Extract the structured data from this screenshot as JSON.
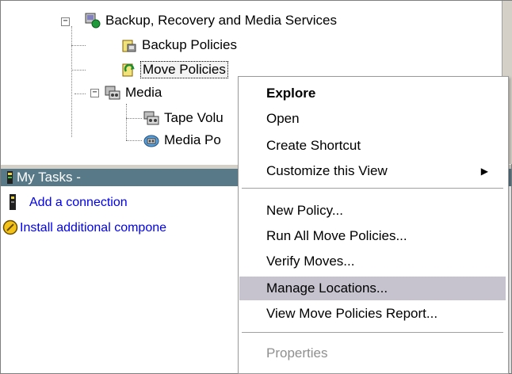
{
  "tree": {
    "root": {
      "label": "Backup, Recovery and Media Services",
      "expander": "−",
      "icon": "backup-services-icon"
    },
    "items": [
      {
        "label": "Backup Policies",
        "icon": "backup-policies-icon"
      },
      {
        "label": "Move Policies",
        "icon": "move-policies-icon"
      },
      {
        "label": "Media",
        "expander": "−",
        "icon": "media-icon"
      },
      {
        "label": "Tape Volu",
        "icon": "tape-volume-icon"
      },
      {
        "label": "Media Po",
        "icon": "media-pool-icon"
      }
    ]
  },
  "tasks": {
    "title": "My Tasks -",
    "links": [
      {
        "label": "Add a connection",
        "icon": "connection-icon"
      },
      {
        "label": "Install additional compone",
        "icon": "install-icon"
      }
    ]
  },
  "context_menu": {
    "items": [
      {
        "label": "Explore"
      },
      {
        "label": "Open"
      },
      {
        "label": "Create Shortcut"
      },
      {
        "label": "Customize this View",
        "arrow": "▶"
      },
      {
        "label": "New Policy..."
      },
      {
        "label": "Run All Move Policies..."
      },
      {
        "label": "Verify Moves..."
      },
      {
        "label": "Manage Locations..."
      },
      {
        "label": "View Move Policies Report..."
      },
      {
        "label": "Properties"
      }
    ]
  },
  "colors": {
    "tasks_bar": "#587a88",
    "menu_hover": "#c6c3cf",
    "link": "#0000ee",
    "disabled": "#8f8f8f"
  }
}
